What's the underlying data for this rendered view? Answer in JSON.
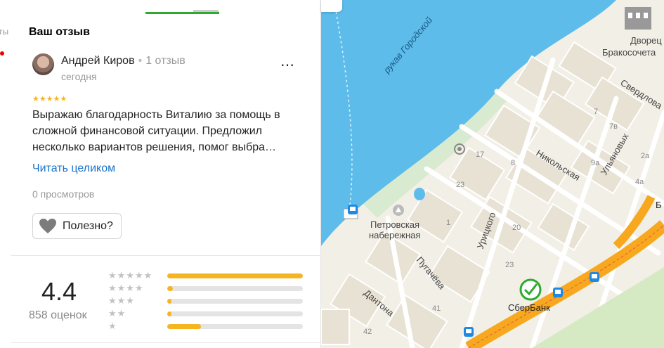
{
  "left_strip": {
    "text": "ты"
  },
  "review": {
    "section_title": "Ваш отзыв",
    "author_name": "Андрей Киров",
    "author_review_count": "1 отзыв",
    "date": "сегодня",
    "more_icon": "⋯",
    "stars": "★★★★★",
    "rating_value": 5,
    "text": "Выражаю благодарность Виталию за помощь в сложной финансовой ситуации. Предложил несколько вариантов решения, помог выбра…",
    "read_more_label": "Читать целиком",
    "views": "0 просмотров",
    "useful_label": "Полезно?"
  },
  "rating": {
    "value": "4.4",
    "count": "858 оценок",
    "rows": [
      {
        "stars": "★★★★★",
        "fraction": 1.0
      },
      {
        "stars": "★★★★",
        "fraction": 0.04
      },
      {
        "stars": "★★★",
        "fraction": 0.03
      },
      {
        "stars": "★★",
        "fraction": 0.03
      },
      {
        "stars": "★",
        "fraction": 0.25
      }
    ]
  },
  "map": {
    "labels": {
      "river": "рукав Городской",
      "palace_1": "Дворец",
      "palace_2": "Бракосочета",
      "street_sverdl": "Свердлова",
      "street_nikol": "Никольская",
      "street_ulyan": "Ульяновых",
      "street_uritsk": "Урицкого",
      "street_pugach": "Пугачёва",
      "street_danton": "Дантона",
      "emb_1": "Петровская",
      "emb_2": "набережная",
      "bank": "СберБанк",
      "edge_b": "Б",
      "h17": "17",
      "h23": "23",
      "h1": "1",
      "h41": "41",
      "h20": "20",
      "h7": "7",
      "h7v": "7в",
      "h9a": "9а",
      "h4a": "4а",
      "h2a": "2а",
      "h8": "8",
      "h42": "42",
      "h23b": "23"
    },
    "colors": {
      "water": "#5dbcea",
      "land": "#f2efe6",
      "road": "#f7a81f",
      "park": "#d5e9c3"
    }
  }
}
